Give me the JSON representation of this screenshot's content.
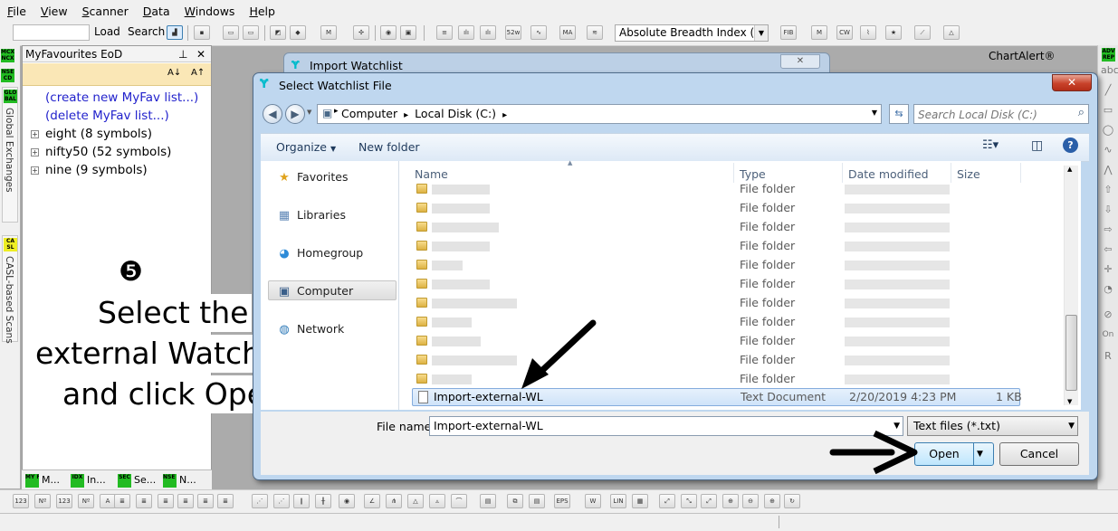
{
  "menu": [
    "File",
    "View",
    "Scanner",
    "Data",
    "Windows",
    "Help"
  ],
  "toolbar": {
    "load_label": "Load",
    "search_label": "Search",
    "index_combo_value": "Absolute Breadth Index (ABI"
  },
  "side_tabs": {
    "global_exchanges": "Global Exchanges",
    "casl_scans": "CASL-based Scans"
  },
  "favourites": {
    "title": "MyFavourites EoD",
    "create_link": "(create new MyFav list...)",
    "delete_link": "(delete MyFav list...)",
    "lists": [
      "eight (8 symbols)",
      "nifty50 (52 symbols)",
      "nine (9 symbols)"
    ]
  },
  "instruction": {
    "step": "❺",
    "line1": "Select the",
    "line2": "external WatchList",
    "line3": "and click Open"
  },
  "bottom_tabs": [
    "M...",
    "In...",
    "Se...",
    "N..."
  ],
  "chartalert_label": "ChartAlert®",
  "import_window": {
    "title": "Import Watchlist"
  },
  "dialog": {
    "title": "Select Watchlist File",
    "breadcrumb": [
      "Computer",
      "Local Disk (C:)"
    ],
    "search_placeholder": "Search Local Disk (C:)",
    "organize_label": "Organize",
    "new_folder_label": "New folder",
    "nav_items": [
      "Favorites",
      "Libraries",
      "Homegroup",
      "Computer",
      "Network"
    ],
    "columns": {
      "name": "Name",
      "type": "Type",
      "date": "Date modified",
      "size": "Size"
    },
    "folder_type": "File folder",
    "folder_count": 11,
    "selected_file": {
      "name": "Import-external-WL",
      "type": "Text Document",
      "date": "2/20/2019 4:23 PM",
      "size": "1 KB"
    },
    "file_name_label": "File name:",
    "file_name_value": "Import-external-WL",
    "file_type_value": "Text files (*.txt)",
    "open_label": "Open",
    "cancel_label": "Cancel"
  },
  "colors": {
    "accent_green": "#22bb22",
    "link_blue": "#2222cc",
    "sort_bar": "#fae7b6",
    "window_frame": "#bfd7ef"
  }
}
